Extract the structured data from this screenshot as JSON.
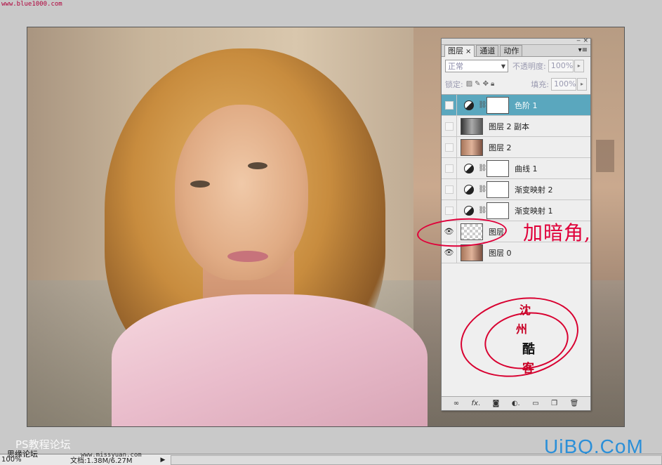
{
  "watermark_top": "www.blue1000.com",
  "panel": {
    "tabs": [
      {
        "label": "图层",
        "close": "×",
        "active": true
      },
      {
        "label": "通道",
        "active": false
      },
      {
        "label": "动作",
        "active": false
      }
    ],
    "blend_mode": "正常",
    "opacity_label": "不透明度:",
    "opacity_value": "100%",
    "lock_label": "锁定:",
    "fill_label": "填充:",
    "fill_value": "100%",
    "layers": [
      {
        "name": "色阶 1",
        "type": "adjustment",
        "visible": false,
        "selected": true
      },
      {
        "name": "图层 2 副本",
        "type": "bw",
        "visible": false,
        "selected": false
      },
      {
        "name": "图层 2",
        "type": "color",
        "visible": false,
        "selected": false
      },
      {
        "name": "曲线 1",
        "type": "adjustment",
        "visible": false,
        "selected": false
      },
      {
        "name": "渐变映射 2",
        "type": "adjustment",
        "visible": false,
        "selected": false
      },
      {
        "name": "渐变映射 1",
        "type": "adjustment",
        "visible": false,
        "selected": false
      },
      {
        "name": "图层",
        "type": "check",
        "visible": true,
        "selected": false
      },
      {
        "name": "图层 0",
        "type": "color",
        "visible": true,
        "selected": false
      }
    ],
    "bottom_icons": [
      "link-icon",
      "fx-icon",
      "mask-icon",
      "adjustment-icon",
      "folder-icon",
      "new-layer-icon",
      "trash-icon"
    ]
  },
  "annotation": {
    "text": "加暗角,",
    "seal_lines": [
      "沈",
      "州",
      "酷",
      "客"
    ]
  },
  "statusbar": {
    "zoom": "100%",
    "docinfo": "文档:1.38M/6.27M"
  },
  "watermark_forum": "PS教程论坛",
  "watermark_forum2": "思缘论坛",
  "watermark_url": "www.missyuan.com",
  "watermark_brand": "UiBQ.CoM",
  "colors": {
    "selected_layer": "#5aa7be",
    "annotation_red": "#e0003a",
    "brand_blue": "#2b8fd8"
  }
}
